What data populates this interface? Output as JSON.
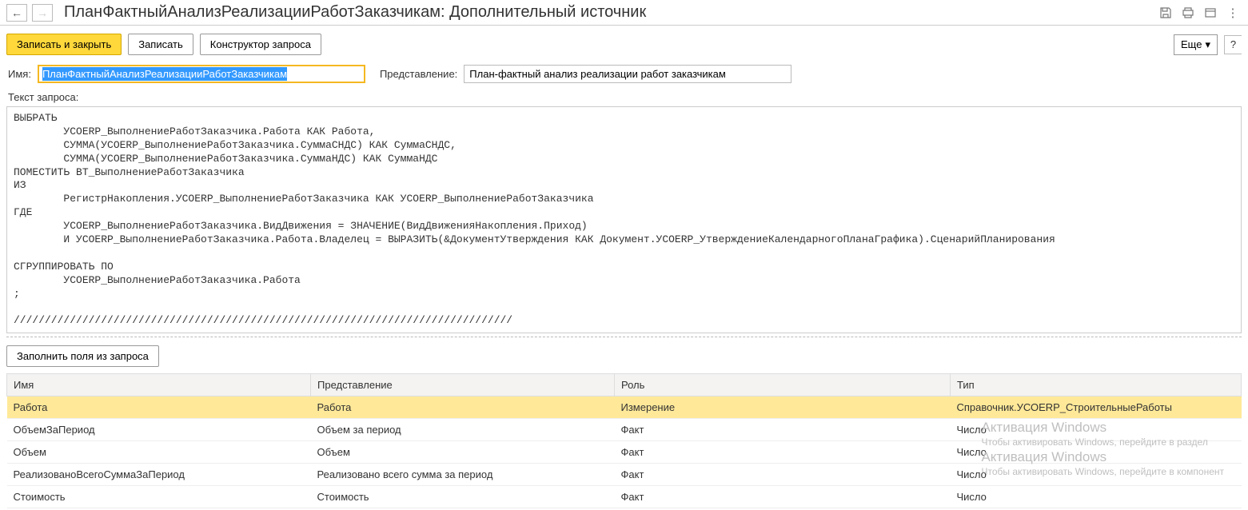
{
  "header": {
    "title": "ПланФактныйАнализРеализацииРаботЗаказчикам: Дополнительный источник"
  },
  "toolbar": {
    "save_close": "Записать и закрыть",
    "save": "Записать",
    "query_constructor": "Конструктор запроса",
    "more": "Еще"
  },
  "form": {
    "name_label": "Имя:",
    "name_value": "ПланФактныйАнализРеализацииРаботЗаказчикам",
    "repr_label": "Представление:",
    "repr_value": "План-фактный анализ реализации работ заказчикам",
    "query_label": "Текст запроса:"
  },
  "query_text": "ВЫБРАТЬ\n        УСОERP_ВыполнениеРаботЗаказчика.Работа КАК Работа,\n        СУММА(УСОERP_ВыполнениеРаботЗаказчика.СуммаСНДС) КАК СуммаСНДС,\n        СУММА(УСОERP_ВыполнениеРаботЗаказчика.СуммаНДС) КАК СуммаНДС\nПОМЕСТИТЬ ВТ_ВыполнениеРаботЗаказчика\nИЗ\n        РегистрНакопления.УСОERP_ВыполнениеРаботЗаказчика КАК УСОERP_ВыполнениеРаботЗаказчика\nГДЕ\n        УСОERP_ВыполнениеРаботЗаказчика.ВидДвижения = ЗНАЧЕНИЕ(ВидДвиженияНакопления.Приход)\n        И УСОERP_ВыполнениеРаботЗаказчика.Работа.Владелец = ВЫРАЗИТЬ(&ДокументУтверждения КАК Документ.УСОERP_УтверждениеКалендарногоПланаГрафика).СценарийПланирования\n\nСГРУППИРОВАТЬ ПО\n        УСОERP_ВыполнениеРаботЗаказчика.Работа\n;\n\n////////////////////////////////////////////////////////////////////////////////",
  "fill_fields_btn": "Заполнить поля из запроса",
  "table": {
    "headers": {
      "name": "Имя",
      "repr": "Представление",
      "role": "Роль",
      "type": "Тип"
    },
    "rows": [
      {
        "name": "Работа",
        "repr": "Работа",
        "role": "Измерение",
        "type": "Справочник.УСОERP_СтроительныеРаботы",
        "selected": true
      },
      {
        "name": "ОбъемЗаПериод",
        "repr": "Объем за период",
        "role": "Факт",
        "type": "Число",
        "selected": false
      },
      {
        "name": "Объем",
        "repr": "Объем",
        "role": "Факт",
        "type": "Число",
        "selected": false
      },
      {
        "name": "РеализованоВсегоСуммаЗаПериод",
        "repr": "Реализовано всего сумма за период",
        "role": "Факт",
        "type": "Число",
        "selected": false
      },
      {
        "name": "Стоимость",
        "repr": "Стоимость",
        "role": "Факт",
        "type": "Число",
        "selected": false
      }
    ]
  },
  "watermark": {
    "line1": "Активация Windows",
    "line2": "Чтобы активировать Windows, перейдите в раздел",
    "line3": "Активация Windows",
    "line4": "Чтобы активировать Windows, перейдите в компонент"
  }
}
